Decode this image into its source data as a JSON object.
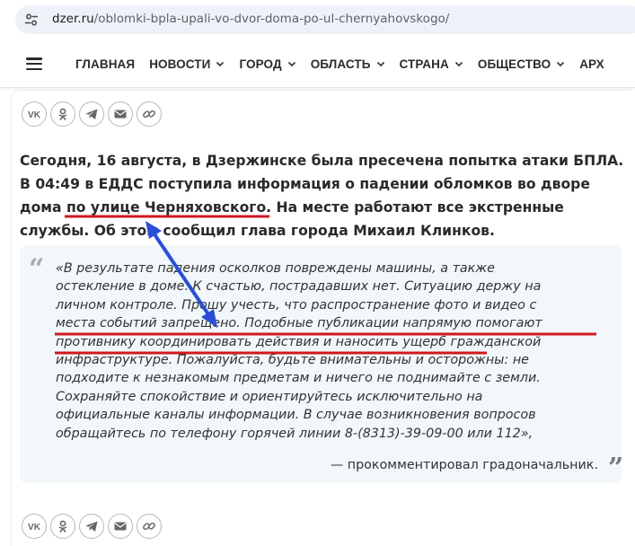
{
  "browser": {
    "url_domain": "dzer.ru",
    "url_path": "/oblomki-bpla-upali-vo-dvor-doma-po-ul-chernyahovskogo/",
    "site_info_icon": "tune-icon"
  },
  "nav": {
    "menu_icon": "hamburger-icon",
    "items": [
      {
        "label": "ГЛАВНАЯ",
        "has_dropdown": false
      },
      {
        "label": "НОВОСТИ",
        "has_dropdown": true
      },
      {
        "label": "ГОРОД",
        "has_dropdown": true
      },
      {
        "label": "ОБЛАСТЬ",
        "has_dropdown": true
      },
      {
        "label": "СТРАНА",
        "has_dropdown": true
      },
      {
        "label": "ОБЩЕСТВО",
        "has_dropdown": true
      },
      {
        "label": "АРХ",
        "has_dropdown": false
      }
    ]
  },
  "share": {
    "icons": [
      "vk-icon",
      "odnoklassniki-icon",
      "telegram-icon",
      "mail-icon",
      "link-icon"
    ]
  },
  "article": {
    "lead_lines": [
      "Сегодня, 16 августа, в Дзержинске была пресечена попытка атаки БПЛА.",
      "В 04:49 в ЕДДС поступила информация о падении обломков во дворе",
      "дома по улице Черняховского. На месте работают все экстренные",
      "службы. Об этом сообщил глава города Михаил Клинков."
    ],
    "quote_lines": [
      "«В результате падения осколков повреждены машины, а также",
      "остекление в доме. К счастью, пострадавших нет. Ситуацию держу на",
      "личном контроле. Прошу учесть, что распространение фото и видео с",
      "места событий запрещено. Подобные публикации напрямую помогают",
      "противнику координировать действия и наносить ущерб гражданской",
      "инфраструктуре. Пожалуйста, будьте внимательны и осторожны: не",
      "подходите к незнакомым предметам и ничего не поднимайте с земли.",
      "Сохраняйте спокойствие и ориентируйтесь исключительно на",
      "официальные каналы информации. В случае возникновения вопросов",
      "обращайтесь по телефону горячей линии 8-(8313)-39-09-00 или 112»,"
    ],
    "quote_attribution": "— прокомментировал градоначальник.",
    "quote_open_mark": "“",
    "quote_close_mark": "”"
  },
  "annotations": {
    "underline_color": "#d01820",
    "arrow_color": "#2a4fd6"
  }
}
